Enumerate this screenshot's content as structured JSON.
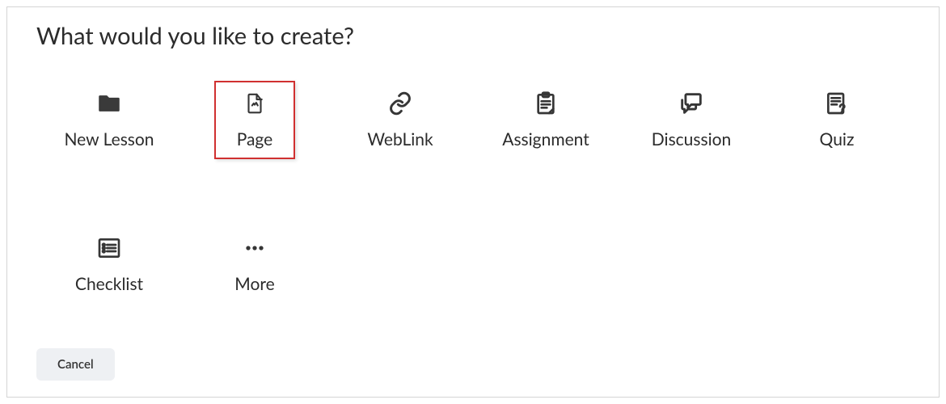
{
  "title": "What would you like to create?",
  "tiles": [
    {
      "label": "New Lesson",
      "icon": "folder",
      "selected": false
    },
    {
      "label": "Page",
      "icon": "page",
      "selected": true
    },
    {
      "label": "WebLink",
      "icon": "link",
      "selected": false
    },
    {
      "label": "Assignment",
      "icon": "assignment",
      "selected": false
    },
    {
      "label": "Discussion",
      "icon": "discussion",
      "selected": false
    },
    {
      "label": "Quiz",
      "icon": "quiz",
      "selected": false
    },
    {
      "label": "Checklist",
      "icon": "checklist",
      "selected": false
    },
    {
      "label": "More",
      "icon": "more",
      "selected": false
    }
  ],
  "footer": {
    "cancel_label": "Cancel"
  }
}
